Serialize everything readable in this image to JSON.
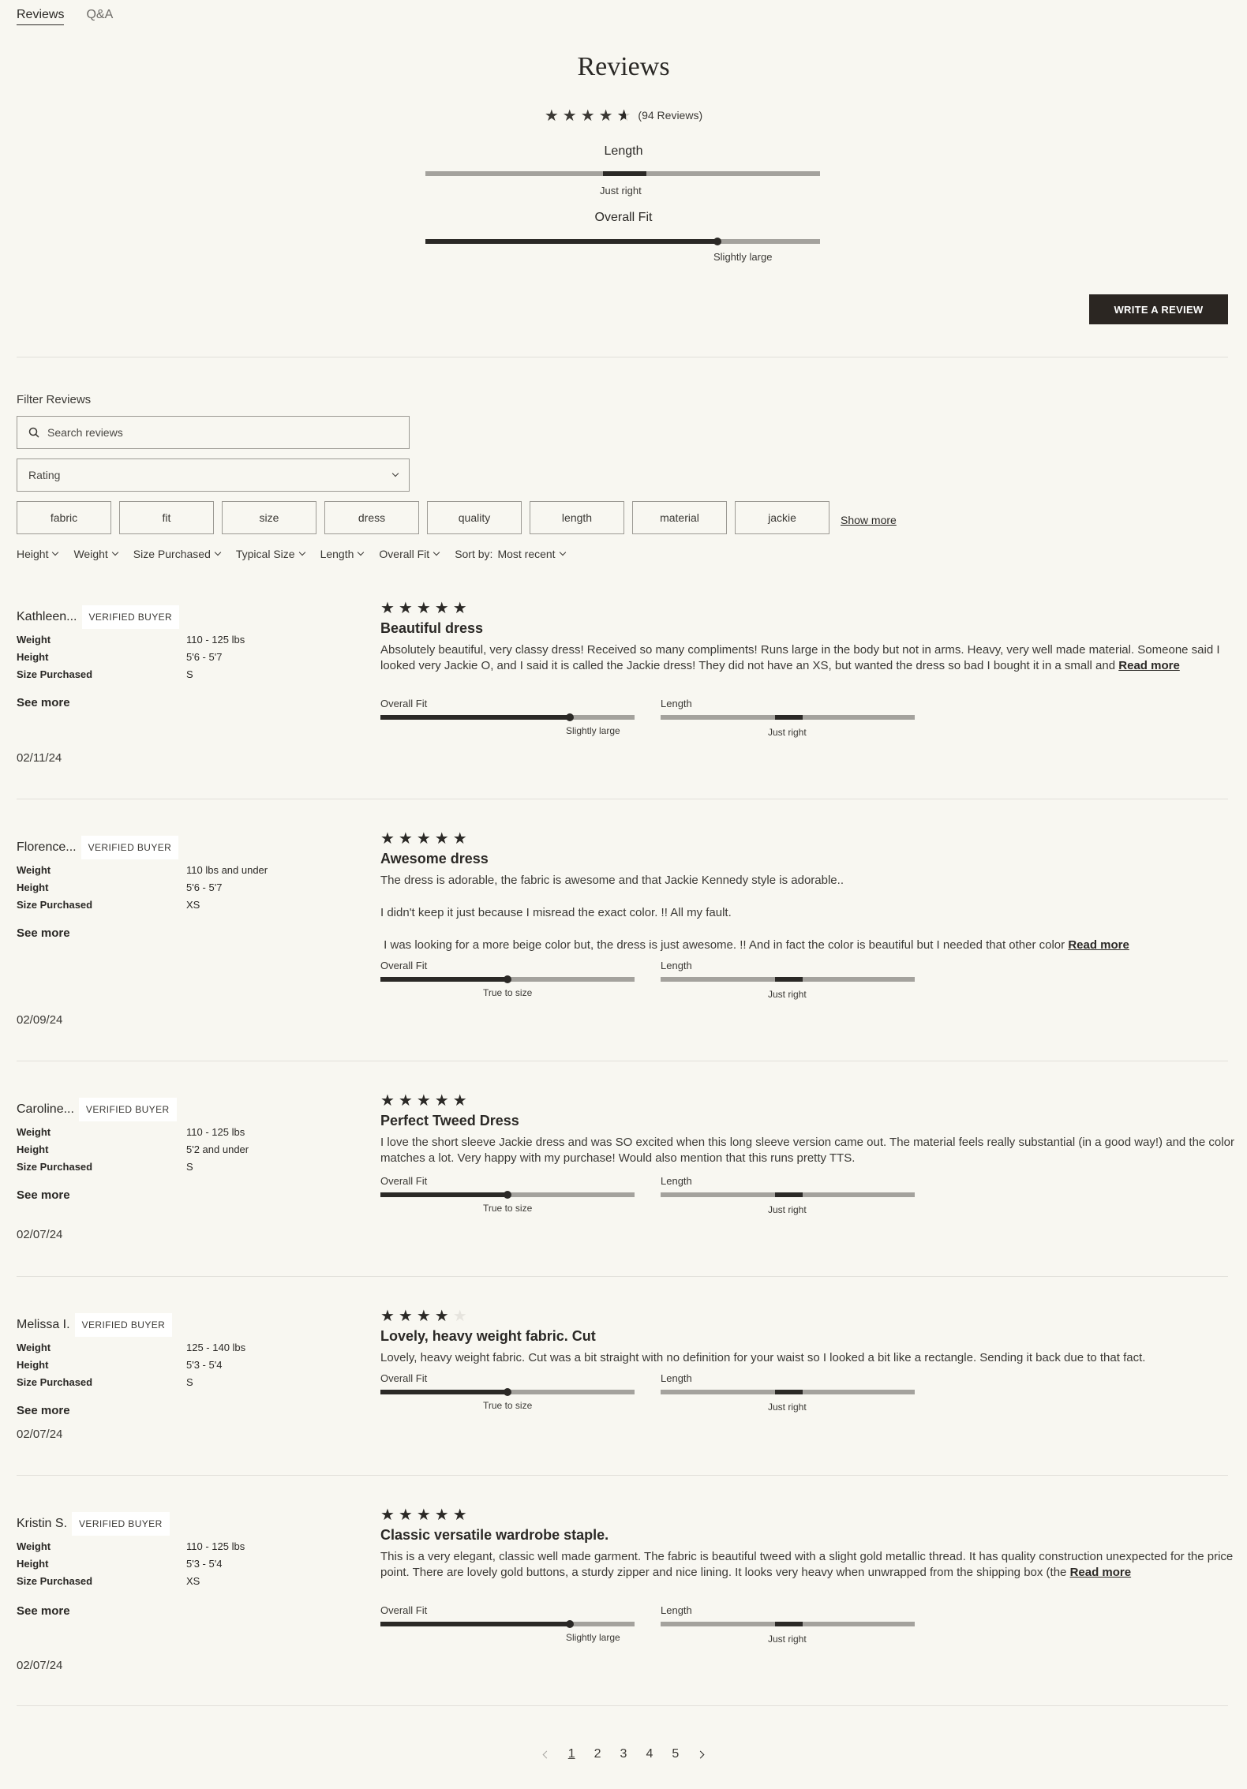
{
  "tabs": [
    {
      "label": "Reviews"
    },
    {
      "label": "Q&A"
    }
  ],
  "title": "Reviews",
  "summary": {
    "stars": "★★★★",
    "count_label": "(94 Reviews)",
    "rating": 4.5
  },
  "aggregate": {
    "length": {
      "label": "Length",
      "value_label": "Just right",
      "position": 0.5
    },
    "overall_fit": {
      "label": "Overall Fit",
      "value_label": "Slightly large",
      "position": 0.74
    }
  },
  "write_review_label": "WRITE A REVIEW",
  "filters": {
    "heading": "Filter Reviews",
    "search_placeholder": "Search reviews",
    "rating_label": "Rating",
    "chips": [
      "fabric",
      "fit",
      "size",
      "dress",
      "quality",
      "length",
      "material",
      "jackie"
    ],
    "show_more": "Show more",
    "dropdowns": [
      "Height",
      "Weight",
      "Size Purchased",
      "Typical Size",
      "Length",
      "Overall Fit"
    ],
    "sort_label": "Sort by:",
    "sort_value": "Most recent"
  },
  "attr_labels": {
    "weight": "Weight",
    "height": "Height",
    "size": "Size Purchased"
  },
  "verified_label": "VERIFIED BUYER",
  "see_more": "See more",
  "read_more": "Read more",
  "fit_label": "Overall Fit",
  "length_label": "Length",
  "reviews": [
    {
      "name": "Kathleen...",
      "weight": "110 - 125 lbs",
      "height": "5'6 - 5'7",
      "size": "S",
      "date": "02/11/24",
      "stars": "★★★★★",
      "rating": 5,
      "title": "Beautiful dress",
      "body": "Absolutely beautiful, very classy dress! Received so many compliments! Runs large in the body but not in arms. Heavy, very well made material. Someone said I looked very Jackie O, and I said it is called the Jackie dress! They did not have an XS, but wanted the dress so bad I bought it in a small and",
      "has_read_more": true,
      "fit_value": "Slightly large",
      "fit_pos": 0.74,
      "length_value": "Just right",
      "length_pos": 0.5
    },
    {
      "name": "Florence...",
      "weight": "110 lbs and under",
      "height": "5'6 - 5'7",
      "size": "XS",
      "date": "02/09/24",
      "stars": "★★★★★",
      "rating": 5,
      "title": "Awesome dress",
      "body_lines": [
        "The dress is adorable, the fabric is awesome and that Jackie Kennedy style is adorable..",
        "I didn't keep it just because I misread the exact color. !! All my fault.",
        " I was looking for a more beige color but, the dress is just awesome. !! And in fact the color is beautiful but I needed that other color"
      ],
      "has_read_more": true,
      "fit_value": "True to size",
      "fit_pos": 0.5,
      "length_value": "Just right",
      "length_pos": 0.5
    },
    {
      "name": "Caroline...",
      "weight": "110 - 125 lbs",
      "height": "5'2 and under",
      "size": "S",
      "date": "02/07/24",
      "stars": "★★★★★",
      "rating": 5,
      "title": "Perfect Tweed Dress",
      "body": "I love the short sleeve Jackie dress and was SO excited when this long sleeve version came out. The material feels really substantial (in a good way!) and the color matches a lot. Very happy with my purchase! Would also mention that this runs pretty TTS.",
      "has_read_more": false,
      "fit_value": "True to size",
      "fit_pos": 0.5,
      "length_value": "Just right",
      "length_pos": 0.5
    },
    {
      "name": "Melissa I.",
      "weight": "125 - 140 lbs",
      "height": "5'3 - 5'4",
      "size": "S",
      "date": "02/07/24",
      "stars": "★★★★",
      "rating": 4,
      "title": "Lovely, heavy weight fabric. Cut",
      "body": "Lovely, heavy weight fabric. Cut was a bit straight with no definition for your waist so I looked a bit like a rectangle. Sending it back due to that fact.",
      "has_read_more": false,
      "fit_value": "True to size",
      "fit_pos": 0.5,
      "length_value": "Just right",
      "length_pos": 0.5
    },
    {
      "name": "Kristin S.",
      "weight": "110 - 125 lbs",
      "height": "5'3 - 5'4",
      "size": "XS",
      "date": "02/07/24",
      "stars": "★★★★★",
      "rating": 5,
      "title": "Classic versatile wardrobe staple.",
      "body": "This is a very elegant, classic well made garment. The fabric is beautiful tweed with a slight gold metallic thread. It has quality construction unexpected for the price point. There are lovely gold buttons, a sturdy zipper and nice lining. It looks very heavy when unwrapped from the shipping box (the",
      "has_read_more": true,
      "fit_value": "Slightly large",
      "fit_pos": 0.74,
      "length_value": "Just right",
      "length_pos": 0.5
    }
  ],
  "pagination": {
    "pages": [
      "1",
      "2",
      "3",
      "4",
      "5"
    ],
    "current": "1"
  }
}
